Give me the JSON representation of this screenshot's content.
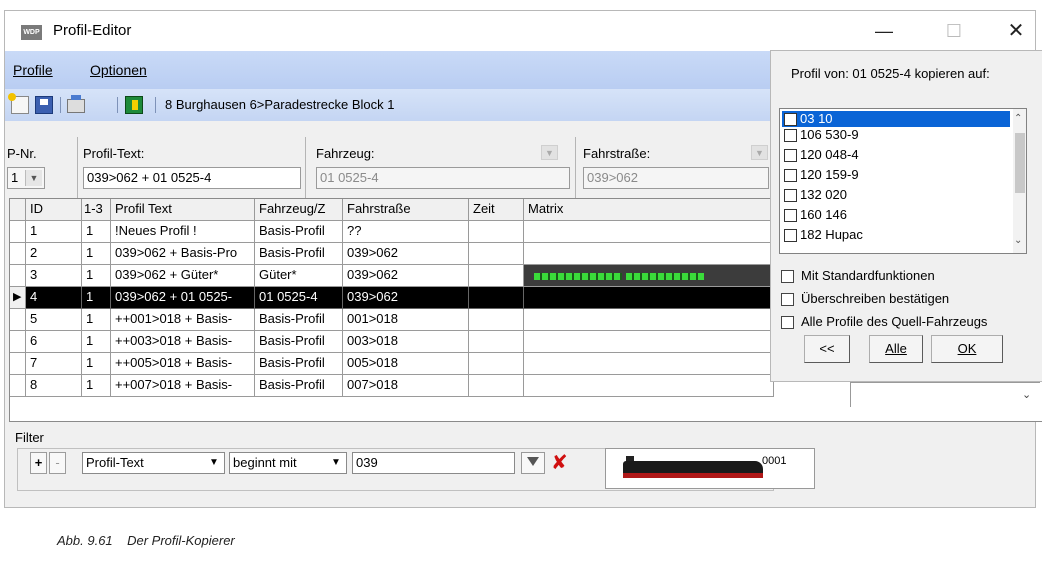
{
  "window": {
    "title": "Profil-Editor",
    "app_icon_text": "WDP"
  },
  "menu": {
    "profile_label": "Profile",
    "options_label": "Optionen"
  },
  "toolbar": {
    "block_text": "8 Burghausen 6>Paradestrecke Block 1"
  },
  "fields": {
    "pnr_label": "P-Nr.",
    "pnr_value": "1",
    "profiltext_label": "Profil-Text:",
    "profiltext_value": "039>062 + 01 0525-4",
    "fahrzeug_label": "Fahrzeug:",
    "fahrzeug_value": "01 0525-4",
    "fahrstrasse_label": "Fahrstraße:",
    "fahrstrasse_value": "039>062"
  },
  "grid": {
    "headers": [
      "ID",
      "1-3",
      "Profil Text",
      "Fahrzeug/Z",
      "Fahrstraße",
      "Zeit",
      "Matrix"
    ],
    "rows": [
      {
        "id": "1",
        "c13": "1",
        "text": "!Neues Profil !",
        "vehicle": "Basis-Profil",
        "route": "??",
        "time": ""
      },
      {
        "id": "2",
        "c13": "1",
        "text": "039>062 + Basis-Pro",
        "vehicle": "Basis-Profil",
        "route": "039>062",
        "time": ""
      },
      {
        "id": "3",
        "c13": "1",
        "text": "039>062 + Güter*",
        "vehicle": "Güter*",
        "route": "039>062",
        "time": ""
      },
      {
        "id": "4",
        "c13": "1",
        "text": "039>062 + 01 0525-",
        "vehicle": "01 0525-4",
        "route": "039>062",
        "time": ""
      },
      {
        "id": "5",
        "c13": "1",
        "text": "++001>018 + Basis-",
        "vehicle": "Basis-Profil",
        "route": "001>018",
        "time": ""
      },
      {
        "id": "6",
        "c13": "1",
        "text": "++003>018 + Basis-",
        "vehicle": "Basis-Profil",
        "route": "003>018",
        "time": ""
      },
      {
        "id": "7",
        "c13": "1",
        "text": "++005>018 + Basis-",
        "vehicle": "Basis-Profil",
        "route": "005>018",
        "time": ""
      },
      {
        "id": "8",
        "c13": "1",
        "text": "++007>018 + Basis-",
        "vehicle": "Basis-Profil",
        "route": "007>018",
        "time": ""
      }
    ],
    "selected_row_index": 3,
    "matrix_led_color": "#3adb3a"
  },
  "filter": {
    "label": "Filter",
    "plus_label": "+",
    "minus_label": "-",
    "field_value": "Profil-Text",
    "operator_value": "beginnt mit",
    "value": "039",
    "loco_label": "0001"
  },
  "popup": {
    "title": "Profil von: 01 0525-4 kopieren auf:",
    "items": [
      "03 10",
      "106 530-9",
      "120 048-4",
      "120 159-9",
      "132 020",
      "160 146",
      "182 Hupac"
    ],
    "selected_item_index": 0,
    "options": [
      "Mit Standardfunktionen",
      "Überschreiben bestätigen",
      "Alle Profile des Quell-Fahrzeugs"
    ],
    "back_label": "<<",
    "all_label": "Alle",
    "ok_label": "OK"
  },
  "caption": "Abb. 9.61    Der Profil-Kopierer",
  "colors": {
    "menu_bg": "#c9daf7",
    "selection": "#0a64d6",
    "grid_selected": "#000000"
  }
}
